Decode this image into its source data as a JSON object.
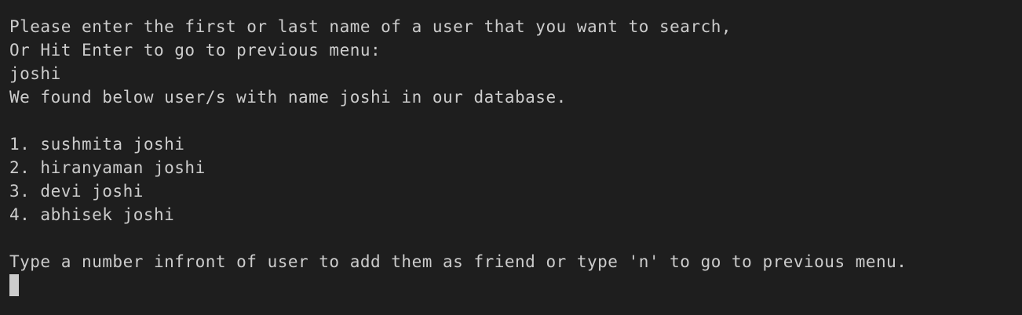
{
  "colors": {
    "background": "#1e1e1e",
    "text": "#cccccc",
    "cursor": "#cccccc"
  },
  "terminal": {
    "prompt_line1": "Please enter the first or last name of a user that you want to search,",
    "prompt_line2": "Or Hit Enter to go to previous menu:",
    "user_input": "joshi",
    "result_message": "We found below user/s with name joshi in our database.",
    "results": [
      "1. sushmita joshi",
      "2. hiranyaman joshi",
      "3. devi joshi",
      "4. abhisek joshi"
    ],
    "action_prompt": "Type a number infront of user to add them as friend or type 'n' to go to previous menu."
  }
}
